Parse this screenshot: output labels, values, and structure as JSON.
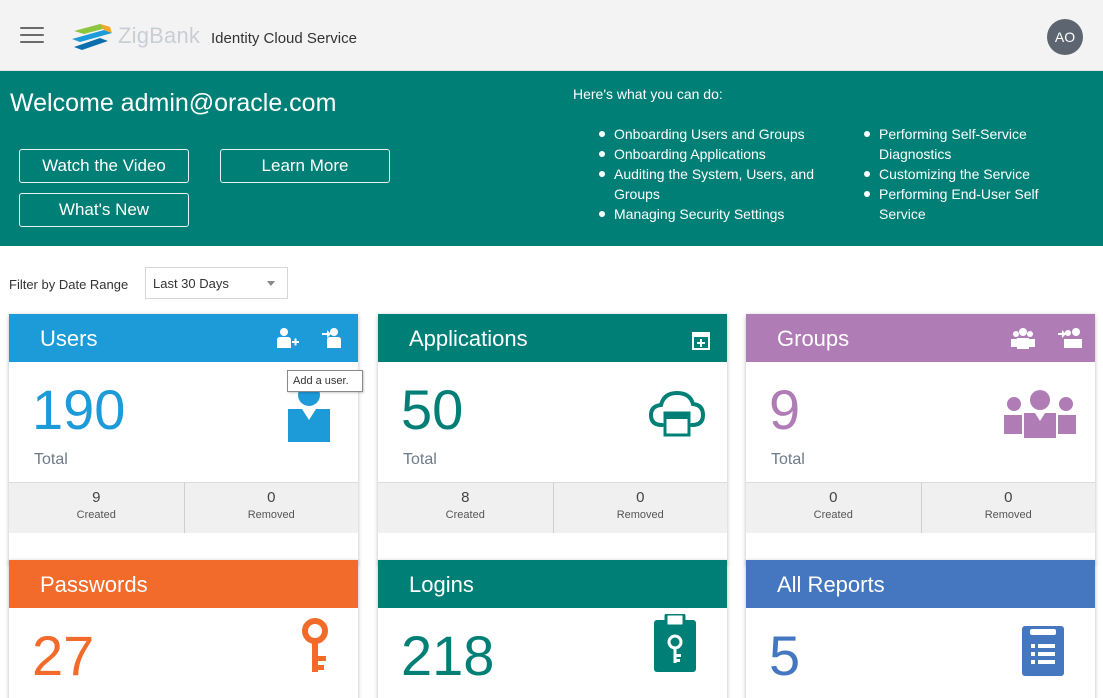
{
  "header": {
    "brand": "ZigBank",
    "subtitle": "Identity Cloud Service",
    "avatar": "AO"
  },
  "banner": {
    "welcome": "Welcome admin@oracle.com",
    "buttons": {
      "video": "Watch the Video",
      "learn": "Learn More",
      "new": "What's New"
    },
    "heading": "Here's what you can do:",
    "left_list": [
      "Onboarding Users and Groups",
      "Onboarding Applications",
      "Auditing the System, Users, and Groups",
      "Managing Security Settings"
    ],
    "right_list": [
      "Performing Self-Service Diagnostics",
      "Customizing the Service",
      "Performing End-User Self Service"
    ]
  },
  "filter": {
    "label": "Filter by Date Range",
    "value": "Last 30 Days"
  },
  "tooltip": "Add a user.",
  "tiles": {
    "users": {
      "title": "Users",
      "count": "190",
      "total": "Total",
      "created": "9",
      "created_label": "Created",
      "removed": "0",
      "removed_label": "Removed",
      "color": "#1d9bd9",
      "icons": [
        "add-user-icon",
        "import-users-icon",
        "user-icon"
      ]
    },
    "applications": {
      "title": "Applications",
      "count": "50",
      "total": "Total",
      "created": "8",
      "created_label": "Created",
      "removed": "0",
      "removed_label": "Removed",
      "color": "#007f76",
      "icons": [
        "add-application-icon",
        "cloud-app-icon"
      ]
    },
    "groups": {
      "title": "Groups",
      "count": "9",
      "total": "Total",
      "created": "0",
      "created_label": "Created",
      "removed": "0",
      "removed_label": "Removed",
      "color": "#b07cb6",
      "icons": [
        "add-group-icon",
        "import-groups-icon",
        "group-icon"
      ]
    },
    "passwords": {
      "title": "Passwords",
      "count": "27",
      "color": "#f26b2a",
      "icons": [
        "key-icon"
      ]
    },
    "logins": {
      "title": "Logins",
      "count": "218",
      "color": "#007f76",
      "icons": [
        "login-badge-icon"
      ]
    },
    "reports": {
      "title": "All Reports",
      "count": "5",
      "color": "#4577c1",
      "icons": [
        "report-icon"
      ]
    }
  }
}
